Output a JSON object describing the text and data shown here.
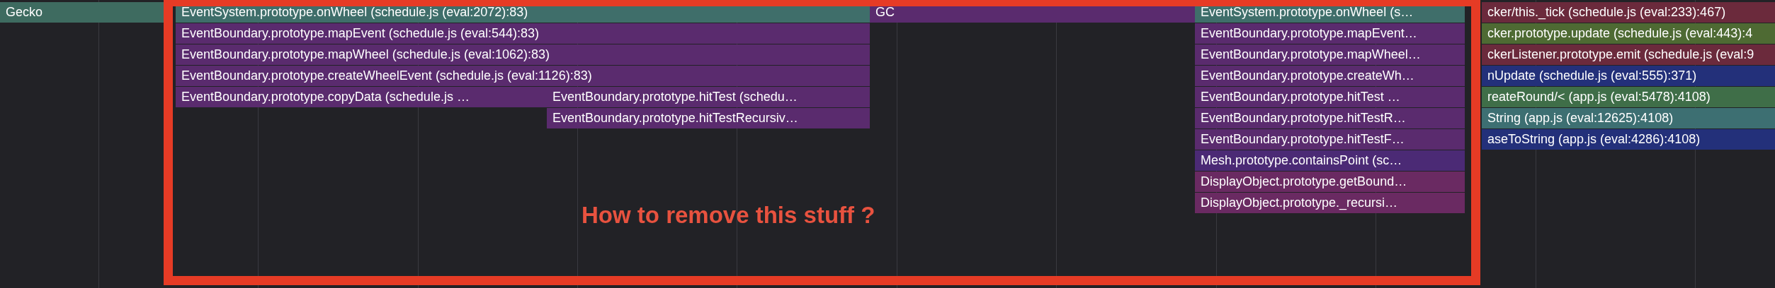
{
  "flame_graph": {
    "rows": [
      {
        "frames": [
          {
            "label": "Gecko",
            "color": "#3e6b60"
          },
          {
            "label": "EventSystem.prototype.onWheel (schedule.js (eval:2072):83)",
            "color": "#3f6e6a"
          },
          {
            "label": "GC",
            "color": "#5a2b6e"
          },
          {
            "label": "EventSystem.prototype.onWheel (s…",
            "color": "#3f6e6a"
          },
          {
            "label": "cker/this._tick (schedule.js (eval:233):467)",
            "color": "#6b2a3c"
          }
        ]
      },
      {
        "frames": [
          {
            "label": "EventBoundary.prototype.mapEvent (schedule.js (eval:544):83)",
            "color": "#5a2b6e"
          },
          {
            "label": "EventBoundary.prototype.mapEvent…",
            "color": "#5a2b6e"
          },
          {
            "label": "cker.prototype.update (schedule.js (eval:443):4",
            "color": "#4e6a33"
          }
        ]
      },
      {
        "frames": [
          {
            "label": "EventBoundary.prototype.mapWheel (schedule.js (eval:1062):83)",
            "color": "#5a2b6e"
          },
          {
            "label": "EventBoundary.prototype.mapWheel…",
            "color": "#5a2b6e"
          },
          {
            "label": "ckerListener.prototype.emit (schedule.js (eval:9",
            "color": "#6b2a3c"
          }
        ]
      },
      {
        "frames": [
          {
            "label": "EventBoundary.prototype.createWheelEvent (schedule.js (eval:1126):83)",
            "color": "#5a2b6e"
          },
          {
            "label": "EventBoundary.prototype.createWh…",
            "color": "#5a2b6e"
          },
          {
            "label": "nUpdate (schedule.js (eval:555):371)",
            "color": "#23307a"
          }
        ]
      },
      {
        "frames": [
          {
            "label": "EventBoundary.prototype.copyData (schedule.js …",
            "color": "#5a2b6e"
          },
          {
            "label": "EventBoundary.prototype.hitTest (schedu…",
            "color": "#5a2b6e"
          },
          {
            "label": "EventBoundary.prototype.hitTest …",
            "color": "#5a2b6e"
          },
          {
            "label": "reateRound/< (app.js (eval:5478):4108)",
            "color": "#3f6e48"
          }
        ]
      },
      {
        "frames": [
          {
            "label": "EventBoundary.prototype.hitTestRecursiv…",
            "color": "#5a2b6e"
          },
          {
            "label": "EventBoundary.prototype.hitTestR…",
            "color": "#5a2b6e"
          },
          {
            "label": "String (app.js (eval:12625):4108)",
            "color": "#3d6f72"
          }
        ]
      },
      {
        "frames": [
          {
            "label": "EventBoundary.prototype.hitTestF…",
            "color": "#5a2b6e"
          },
          {
            "label": "aseToString (app.js (eval:4286):4108)",
            "color": "#23307a"
          }
        ]
      },
      {
        "frames": [
          {
            "label": "Mesh.prototype.containsPoint (sc…",
            "color": "#4b2a75"
          }
        ]
      },
      {
        "frames": [
          {
            "label": "DisplayObject.prototype.getBound…",
            "color": "#6a2a62"
          }
        ]
      },
      {
        "frames": [
          {
            "label": "DisplayObject.prototype._recursi…",
            "color": "#6a2a62"
          }
        ]
      }
    ]
  },
  "annotation": {
    "text": "How to remove this stuff ?"
  }
}
